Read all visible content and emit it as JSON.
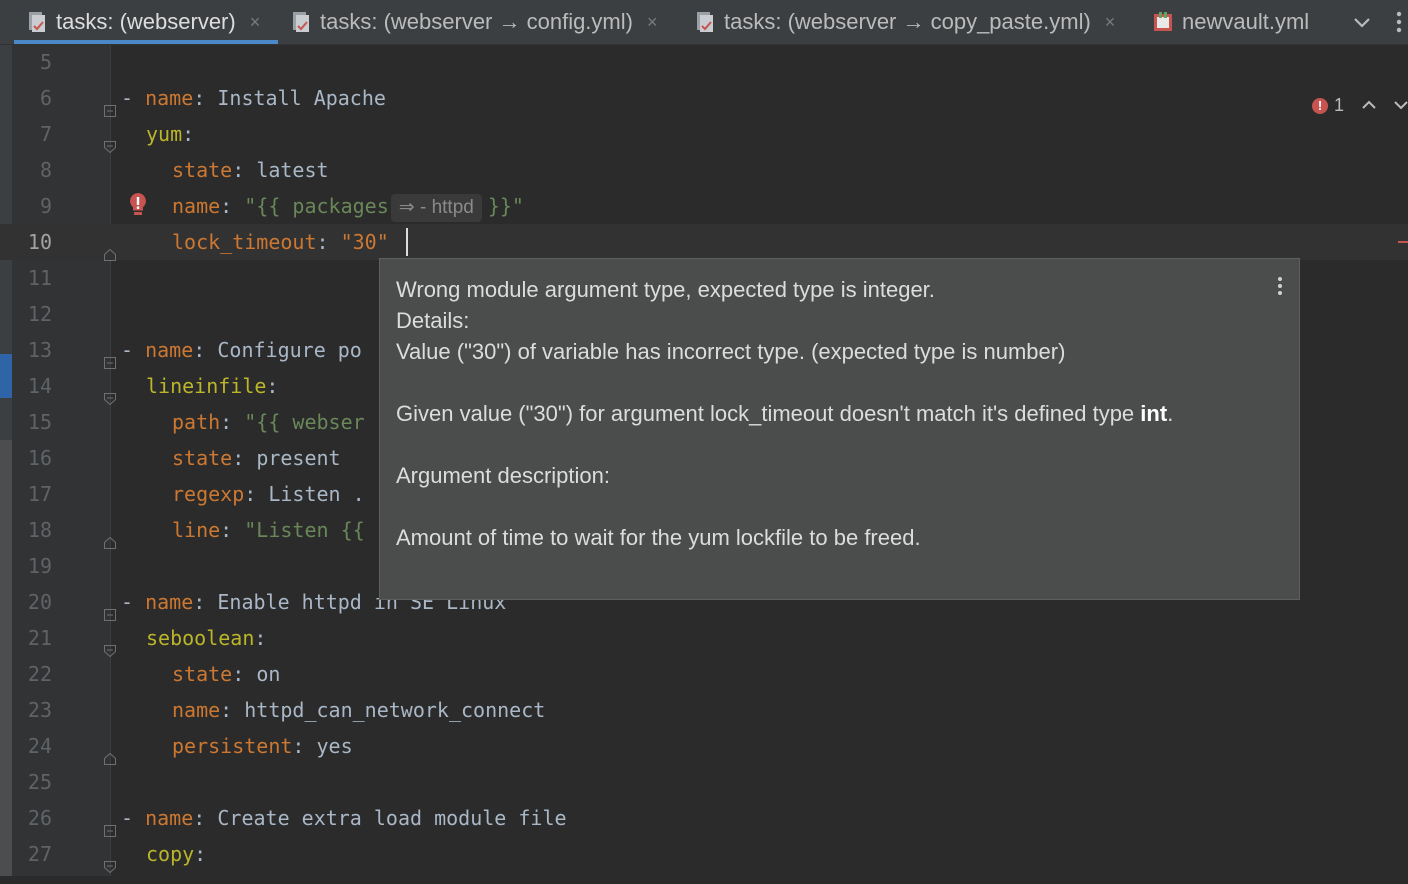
{
  "tabs": [
    {
      "label": "tasks: (webserver)",
      "active": true,
      "closable": true
    },
    {
      "label": "tasks: (webserver → config.yml)",
      "active": false,
      "closable": true
    },
    {
      "label": "tasks: (webserver → copy_paste.yml)",
      "active": false,
      "closable": true
    },
    {
      "label": "newvault.yml",
      "active": false,
      "closable": false
    }
  ],
  "tab_close_glyph": "×",
  "editor": {
    "inspection": {
      "error_count": "1"
    },
    "lines": [
      {
        "num": "5"
      },
      {
        "num": "6",
        "dash": "- ",
        "key": "name",
        "sep": ": ",
        "val": "Install Apache"
      },
      {
        "num": "7",
        "key": "yum",
        "sep": ":"
      },
      {
        "num": "8",
        "key": "state",
        "sep": ": ",
        "val": "latest"
      },
      {
        "num": "9",
        "key": "name",
        "sep": ": ",
        "val_a": "\"{{ packages",
        "hint": "⇒ - httpd",
        "val_b": "}}\""
      },
      {
        "num": "10",
        "key": "lock_timeout",
        "sep": ": ",
        "val": "\"30\""
      },
      {
        "num": "11"
      },
      {
        "num": "12"
      },
      {
        "num": "13",
        "dash": "- ",
        "key": "name",
        "sep": ": ",
        "val": "Configure po"
      },
      {
        "num": "14",
        "key": "lineinfile",
        "sep": ":"
      },
      {
        "num": "15",
        "key": "path",
        "sep": ": ",
        "val": "\"{{ webser"
      },
      {
        "num": "16",
        "key": "state",
        "sep": ": ",
        "val": "present"
      },
      {
        "num": "17",
        "key": "regexp",
        "sep": ": ",
        "val": "Listen ."
      },
      {
        "num": "18",
        "key": "line",
        "sep": ": ",
        "val": "\"Listen {{"
      },
      {
        "num": "19"
      },
      {
        "num": "20",
        "dash": "- ",
        "key": "name",
        "sep": ": ",
        "val": "Enable httpd in SE Linux"
      },
      {
        "num": "21",
        "key": "seboolean",
        "sep": ":"
      },
      {
        "num": "22",
        "key": "state",
        "sep": ": ",
        "val": "on"
      },
      {
        "num": "23",
        "key": "name",
        "sep": ": ",
        "val": "httpd_can_network_connect"
      },
      {
        "num": "24",
        "key": "persistent",
        "sep": ": ",
        "val": "yes"
      },
      {
        "num": "25"
      },
      {
        "num": "26",
        "dash": "- ",
        "key": "name",
        "sep": ": ",
        "val": "Create extra load module file"
      },
      {
        "num": "27",
        "key": "copy",
        "sep": ":"
      }
    ]
  },
  "tooltip": {
    "title": "Wrong module argument type, expected type is integer.",
    "details_label": "Details:",
    "detail_line": "Value (\"30\") of variable has incorrect type. (expected type is number)",
    "given_prefix": "Given value (\"30\") for argument lock_timeout doesn't match it's defined type ",
    "given_type": "int",
    "given_suffix": ".",
    "arg_desc_label": "Argument description:",
    "arg_desc": "Amount of time to wait for the yum lockfile to be freed."
  },
  "colors": {
    "background": "#2b2b2b",
    "key": "#cc7832",
    "module_key": "#bbb529",
    "string": "#6a8759",
    "error": "#c75450",
    "active_tab_underline": "#4a88c7"
  }
}
